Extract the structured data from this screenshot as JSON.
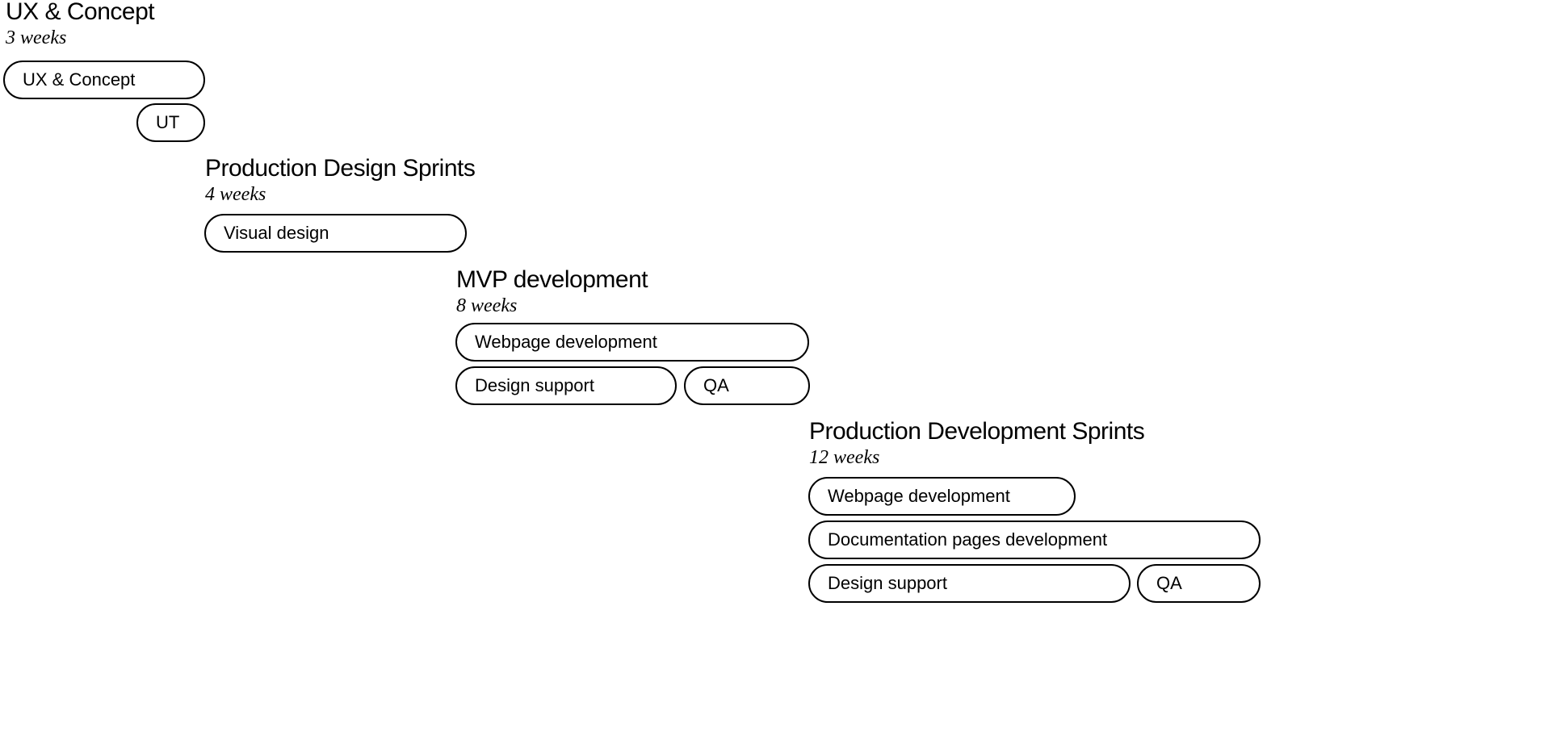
{
  "colors": {
    "background": "#ffffff",
    "ink": "#000000"
  },
  "phases": [
    {
      "title": "UX & Concept",
      "duration": "3 weeks",
      "tasks": [
        {
          "label": "UX & Concept"
        },
        {
          "label": "UT"
        }
      ]
    },
    {
      "title": "Production Design Sprints",
      "duration": "4 weeks",
      "tasks": [
        {
          "label": "Visual design"
        }
      ]
    },
    {
      "title": "MVP development",
      "duration": "8 weeks",
      "tasks": [
        {
          "label": "Webpage development"
        },
        {
          "label": "Design support"
        },
        {
          "label": "QA"
        }
      ]
    },
    {
      "title": "Production Development Sprints",
      "duration": "12 weeks",
      "tasks": [
        {
          "label": "Webpage development"
        },
        {
          "label": "Documentation pages development"
        },
        {
          "label": "Design support"
        },
        {
          "label": "QA"
        }
      ]
    }
  ]
}
